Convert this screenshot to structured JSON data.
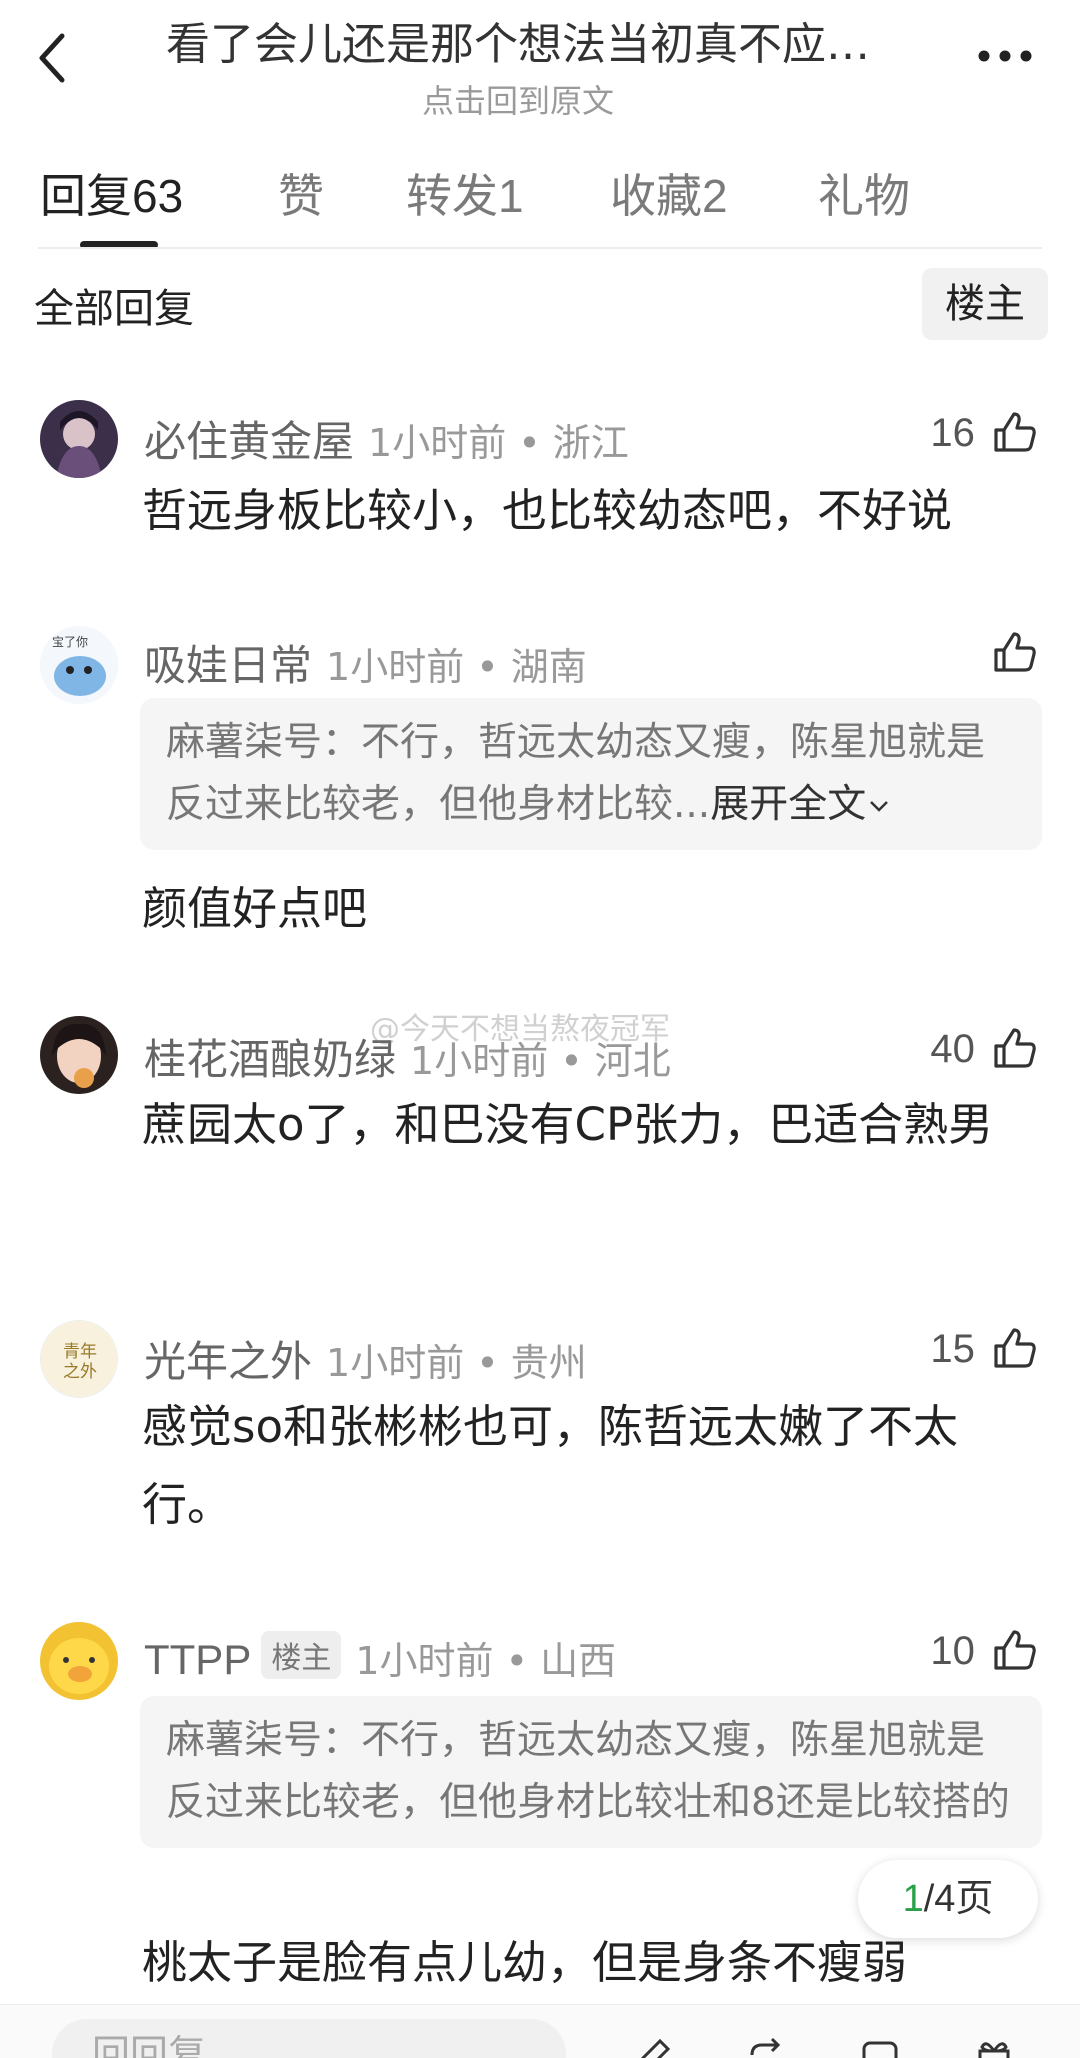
{
  "header": {
    "title": "看了会儿还是那个想法当初真不应…",
    "subtitle": "点击回到原文"
  },
  "tabs": [
    {
      "label": "回复",
      "count": "63"
    },
    {
      "label": "赞",
      "count": ""
    },
    {
      "label": "转发",
      "count": "1"
    },
    {
      "label": "收藏",
      "count": "2"
    },
    {
      "label": "礼物",
      "count": ""
    }
  ],
  "section": {
    "title": "全部回复",
    "filter": "楼主"
  },
  "comments": [
    {
      "user": "必住黄金屋",
      "time": "1小时前 • 浙江",
      "likes": "16",
      "text": "哲远身板比较小，也比较幼态吧，不好说",
      "avatar_color": "#3b2f4a"
    },
    {
      "user": "吸娃日常",
      "time": "1小时前 • 湖南",
      "likes": "",
      "quote_author": "麻薯柒号",
      "quote_text": "：不行，哲远太幼态又瘦，陈星旭就是反过来比较老，但他身材比较...",
      "expand": "展开全文",
      "text": "颜值好点吧",
      "avatar_color": "#e9f1fa"
    },
    {
      "user": "桂花酒酿奶绿",
      "time": "1小时前 • 河北",
      "likes": "40",
      "text": "蔗园太o了，和巴没有CP张力，巴适合熟男",
      "avatar_color": "#c8a58a"
    },
    {
      "user": "光年之外",
      "time": "1小时前 • 贵州",
      "likes": "15",
      "text": "感觉so和张彬彬也可，陈哲远太嫩了不太行。",
      "avatar_color": "#f3ecd6",
      "avatar_text": "青年之外"
    },
    {
      "user": "TTPP",
      "badge": "楼主",
      "time": "1小时前 • 山西",
      "likes": "10",
      "quote_author": "麻薯柒号",
      "quote_text": "：不行，哲远太幼态又瘦，陈星旭就是反过来比较老，但他身材比较壮和8还是比较搭的",
      "text": "桃太子是脸有点儿幼，但是身条不瘦弱",
      "avatar_color": "#f7c531"
    }
  ],
  "watermark": "@今天不想当熬夜冠军",
  "pager": {
    "current": "1",
    "total": "/4页"
  },
  "bottom": {
    "placeholder": "回回复"
  },
  "colors": {
    "accent_green": "#2aa148"
  }
}
